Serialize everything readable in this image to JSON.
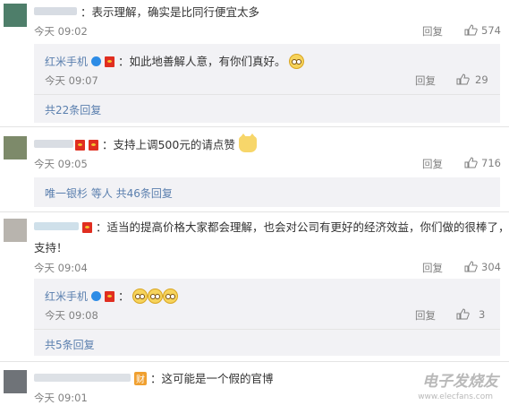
{
  "comments": [
    {
      "text": "：表示理解，确实是比同行便宜太多",
      "time": "今天 09:02",
      "reply_label": "回复",
      "likes": "574",
      "sub": {
        "author": "红米手机",
        "text": "：如此地善解人意，有你们真好。",
        "time": "今天 09:07",
        "reply_label": "回复",
        "likes": "29",
        "more": "共22条回复"
      }
    },
    {
      "text": "：支持上调500元的请点赞",
      "time": "今天 09:05",
      "reply_label": "回复",
      "likes": "716",
      "more_name": "唯一银杉",
      "more_rest": " 等人 共46条回复"
    },
    {
      "text_line1": "：适当的提高价格大家都会理解，也会对公司有更好的经济效益，你们做的很棒了，",
      "text_line2": "支持！",
      "time": "今天 09:04",
      "reply_label": "回复",
      "likes": "304",
      "sub": {
        "author": "红米手机",
        "text": "：",
        "time": "今天 09:08",
        "reply_label": "回复",
        "likes": "3",
        "more": "共5条回复"
      }
    },
    {
      "badge": "财",
      "text": "：这可能是一个假的官博",
      "time": "今天 09:01"
    }
  ],
  "watermark": {
    "main": "电子发烧友",
    "sub": "www.elecfans.com"
  },
  "colors": {
    "link": "#5a7fae",
    "vip_badge": "#2d8ce6",
    "sub_bg": "#f2f2f5"
  },
  "icons": [
    "thumbs-up-icon",
    "verified-v-icon",
    "red-envelope-icon",
    "emoji-face-icon",
    "cat-emoji-icon"
  ]
}
